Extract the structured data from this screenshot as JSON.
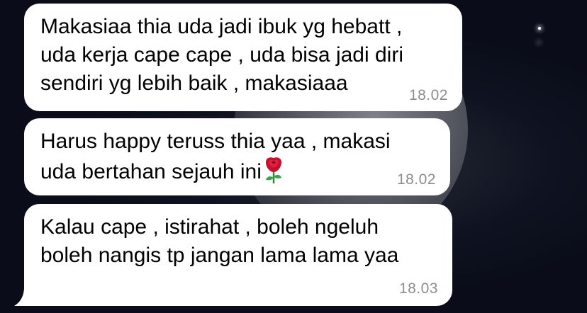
{
  "messages": [
    {
      "lines": [
        "Makasiaa thia uda jadi ibuk yg hebatt ,",
        "uda kerja cape cape , uda bisa jadi diri",
        "sendiri yg lebih baik , makasiaaa"
      ],
      "time": "18.02"
    },
    {
      "lines": [
        "Harus happy teruss thia yaa , makasi",
        "uda bertahan sejauh ini"
      ],
      "emoji": "rose-icon",
      "time": "18.02"
    },
    {
      "lines": [
        "Kalau cape , istirahat , boleh ngeluh",
        "boleh nangis tp jangan lama lama yaa"
      ],
      "time": "18.03"
    }
  ],
  "colors": {
    "bubble": "#ffffff",
    "timestamp": "#8d8d8d",
    "wallpaper": "#0c0f1c"
  }
}
